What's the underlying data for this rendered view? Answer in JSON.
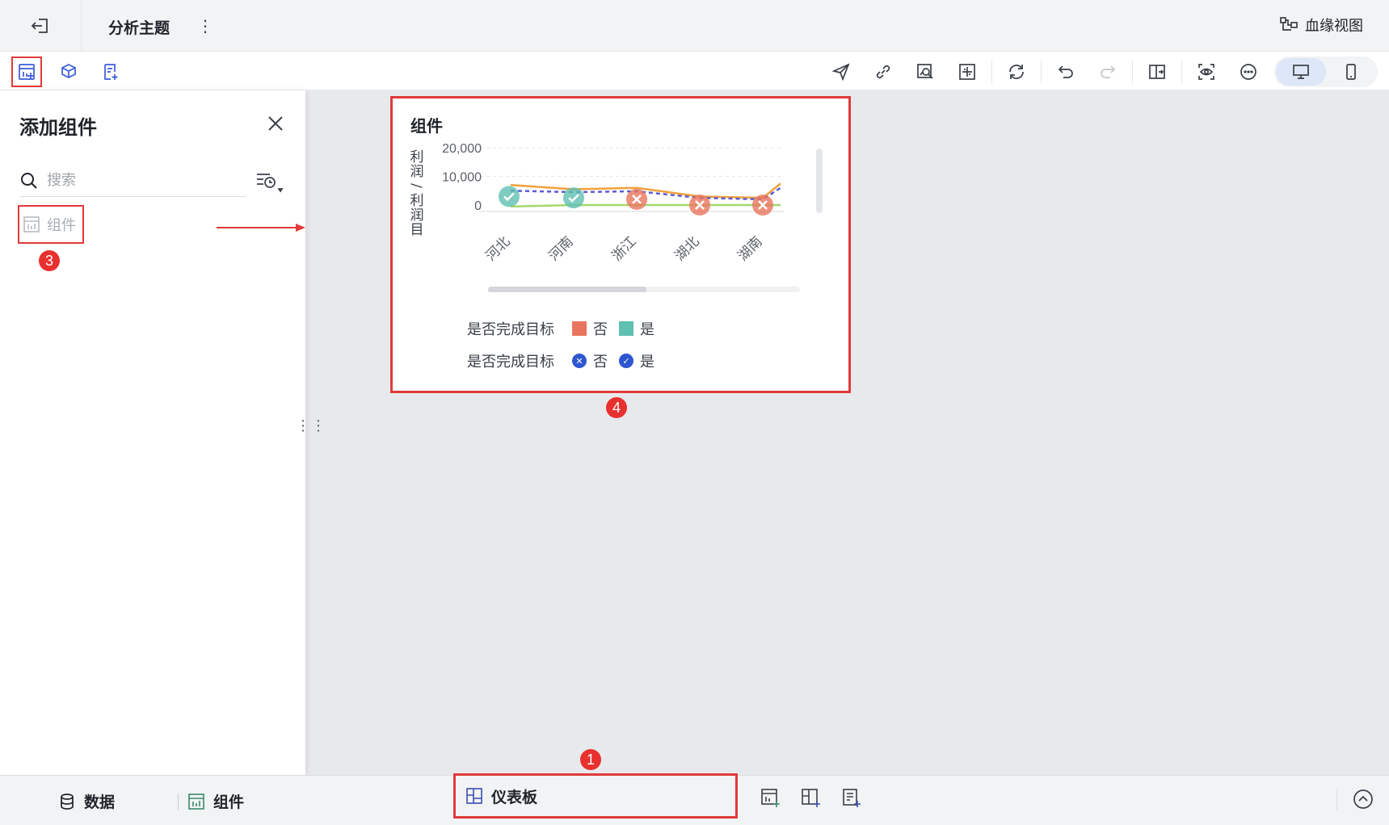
{
  "header": {
    "title": "分析主题",
    "lineage_label": "血缘视图"
  },
  "toolbar": {
    "left_icons": [
      "add-component-icon",
      "dataset-icon",
      "add-text-icon"
    ],
    "right_icons": [
      "send-icon",
      "link-icon",
      "preview-data-icon",
      "grid-icon",
      "refresh-icon",
      "undo-icon",
      "redo-icon",
      "split-view-icon",
      "eye-icon",
      "more-icon",
      "desktop-icon",
      "mobile-icon"
    ]
  },
  "panel": {
    "title": "添加组件",
    "search_placeholder": "搜索",
    "item_label": "组件"
  },
  "badges": [
    "1",
    "2",
    "3",
    "4"
  ],
  "card": {
    "title": "组件",
    "ylabel": "利润/利润目",
    "legend1_title": "是否完成目标",
    "legend1_items": [
      "否",
      "是"
    ],
    "legend2_title": "是否完成目标",
    "legend2_items": [
      "否",
      "是"
    ]
  },
  "chart_data": {
    "type": "line",
    "categories": [
      "河北",
      "河南",
      "浙江",
      "湖北",
      "湖南"
    ],
    "yticks": [
      "20,000",
      "10,000",
      "0"
    ],
    "ylim": [
      0,
      20000
    ],
    "ylabel": "利润/利润目",
    "series": [
      {
        "values": [
          7000,
          5500,
          6000,
          3000,
          2500,
          7500
        ],
        "color": "#f0a13a"
      },
      {
        "values": [
          5000,
          4500,
          4800,
          2500,
          2000,
          6000
        ],
        "color": "#5b5bd6",
        "dashed": true
      },
      {
        "values": [
          -500,
          0,
          0,
          0,
          0,
          0
        ],
        "color": "#a5d86e"
      }
    ],
    "markers": [
      {
        "category": "河北",
        "status": "是",
        "value": 3000
      },
      {
        "category": "河南",
        "status": "是",
        "value": 2500
      },
      {
        "category": "浙江",
        "status": "否",
        "value": 2000
      },
      {
        "category": "湖北",
        "status": "否",
        "value": 0
      },
      {
        "category": "湖南",
        "status": "否",
        "value": 0
      }
    ],
    "legend": [
      {
        "title": "是否完成目标",
        "items": [
          {
            "label": "否",
            "color": "#e8765e"
          },
          {
            "label": "是",
            "color": "#5fbfb0"
          }
        ]
      },
      {
        "title": "是否完成目标",
        "items": [
          {
            "label": "否",
            "icon": "cross"
          },
          {
            "label": "是",
            "icon": "check"
          }
        ]
      }
    ]
  },
  "bottombar": {
    "data_label": "数据",
    "component_label": "组件",
    "dashboard_label": "仪表板"
  }
}
